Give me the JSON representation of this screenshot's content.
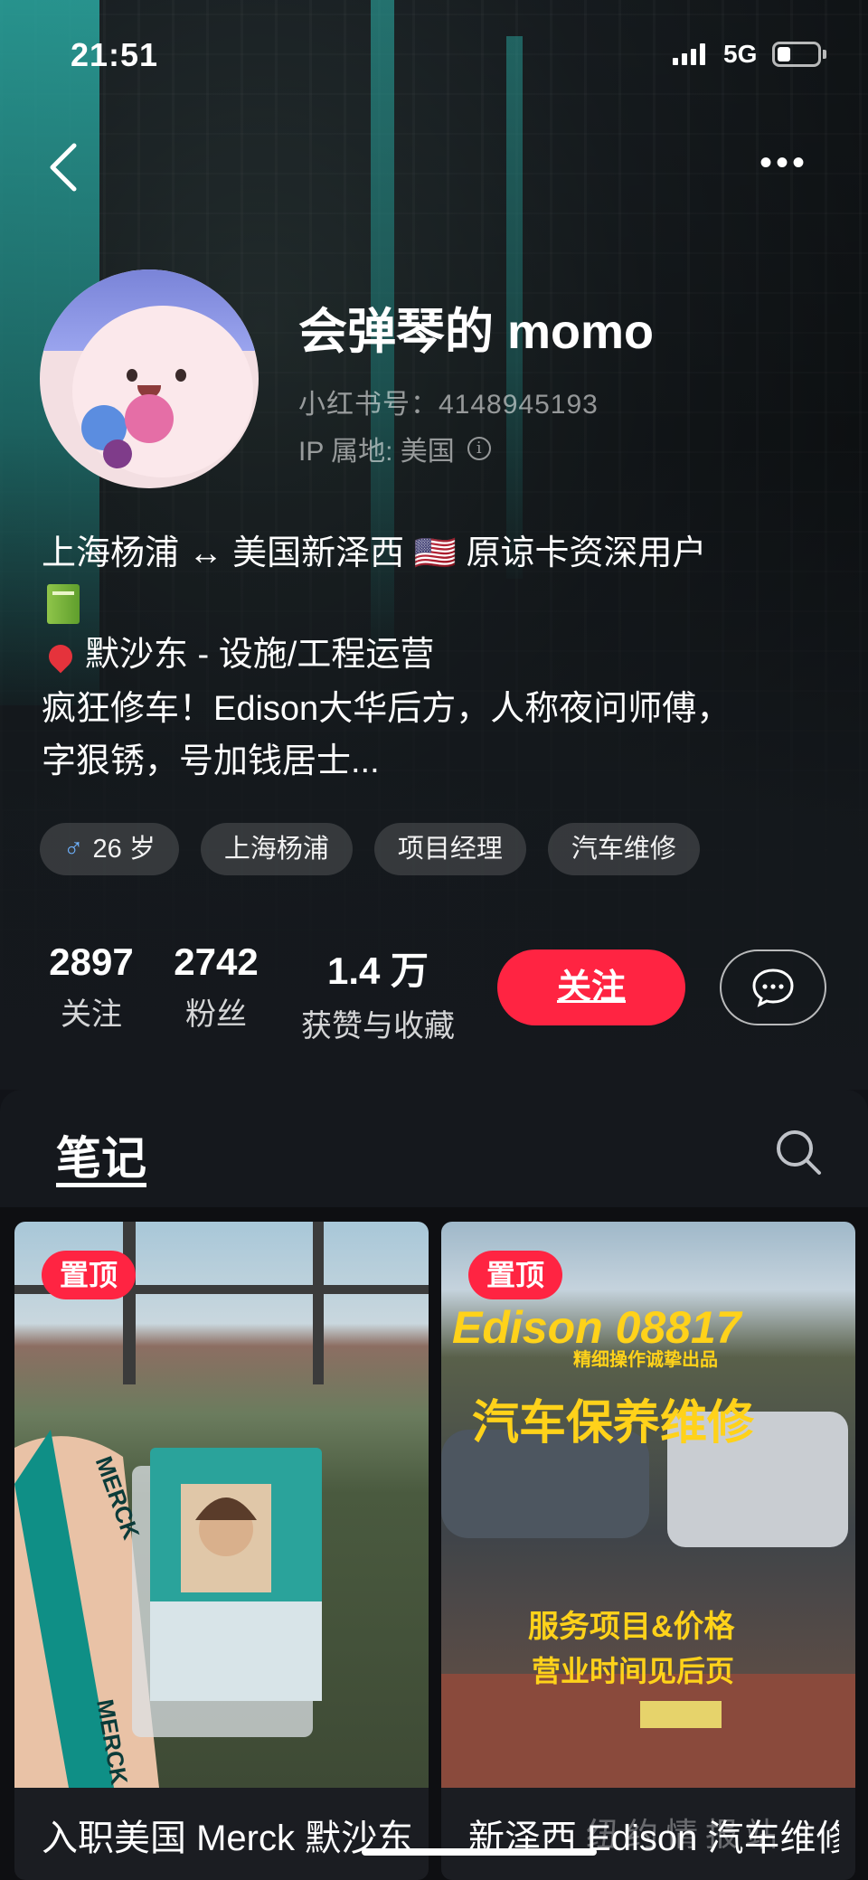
{
  "status_bar": {
    "time": "21:51",
    "network": "5G"
  },
  "profile": {
    "name": "会弹琴的 momo",
    "red_id": "小红书号：4148945193",
    "ip_location": "IP 属地: 美国",
    "bio_line1": "上海杨浦 ↔ 美国新泽西 🇺🇸 原谅卡资深用户",
    "bio_line2": "默沙东 - 设施/工程运营",
    "bio_line3": "疯狂修车！Edison大华后方，人称夜问师傅，",
    "bio_line4": "字狠锈，号加钱居士..."
  },
  "tags": [
    {
      "label": "26 岁",
      "icon": "male-icon"
    },
    {
      "label": "上海杨浦"
    },
    {
      "label": "项目经理"
    },
    {
      "label": "汽车维修"
    }
  ],
  "stats": [
    {
      "value": "2897",
      "label": "关注"
    },
    {
      "value": "2742",
      "label": "粉丝"
    },
    {
      "value": "1.4 万",
      "label": "获赞与收藏"
    }
  ],
  "actions": {
    "follow_label": "关注"
  },
  "tabs": {
    "notes_label": "笔记"
  },
  "notes": [
    {
      "badge": "置顶",
      "title": "入职美国 Merck 默沙东总部 & 面试",
      "image_text": [
        "MERCK",
        "MERCK"
      ]
    },
    {
      "badge": "置顶",
      "title": "新泽西 Edison 汽车维修保养",
      "image_text": [
        "Edison 08817",
        "精细操作诚挚出品",
        "汽车保养维修",
        "服务项目&价格",
        "营业时间见后页"
      ]
    }
  ],
  "watermark": "纽约情报站",
  "colors": {
    "accent": "#ff2442",
    "background": "#111318"
  }
}
